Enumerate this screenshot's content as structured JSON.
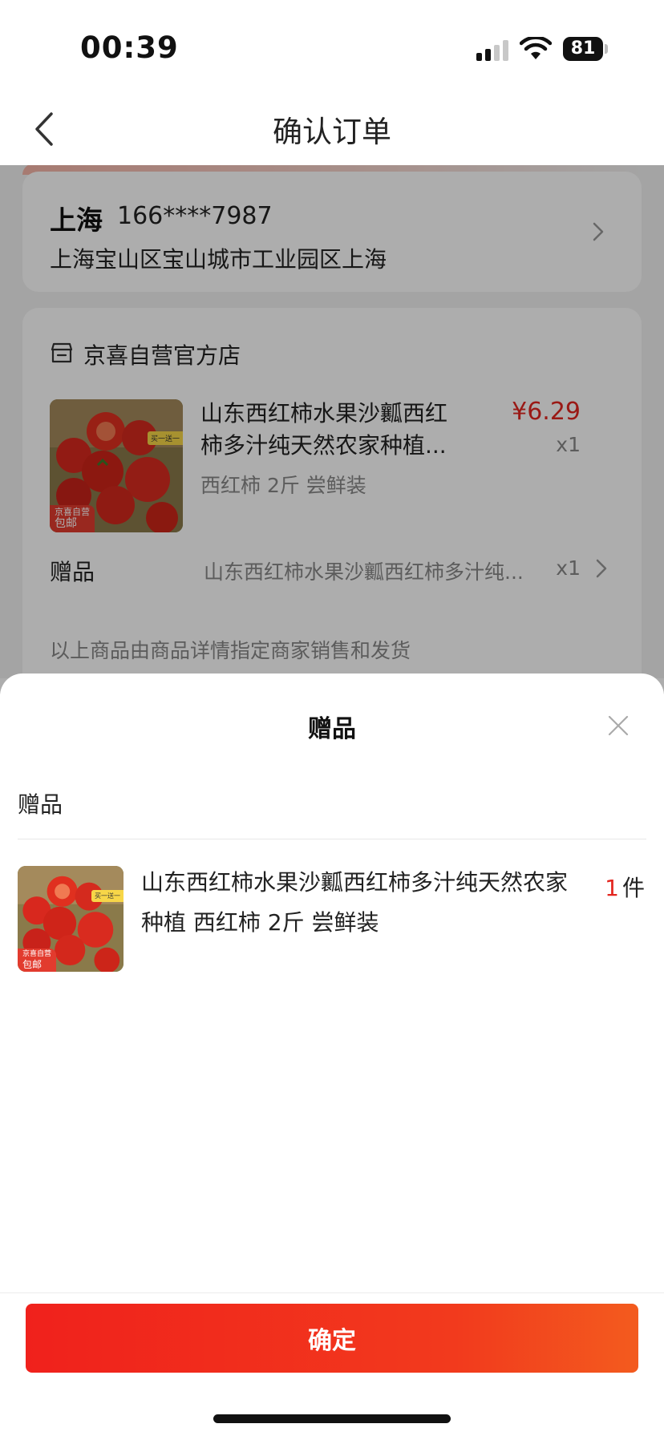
{
  "status_bar": {
    "time": "00:39",
    "battery": "81"
  },
  "nav": {
    "title": "确认订单"
  },
  "address": {
    "city": "上海",
    "phone": "166****7987",
    "detail": "上海宝山区宝山城市工业园区上海"
  },
  "store": {
    "name": "京喜自营官方店"
  },
  "product": {
    "title": "山东西红柿水果沙瓤西红柿多汁纯天然农家种植...",
    "spec": "西红柿 2斤 尝鲜装",
    "price": "¥6.29",
    "qty": "x1",
    "image_tag_top": "买一送一",
    "image_tag_bottom_1": "京喜自营",
    "image_tag_bottom_2": "包邮"
  },
  "gift_row": {
    "label": "赠品",
    "desc": "山东西红柿水果沙瓤西红柿多汁纯...",
    "qty": "x1"
  },
  "seller_note": "以上商品由商品详情指定商家销售和发货",
  "sheet": {
    "title": "赠品",
    "section_label": "赠品",
    "item": {
      "title": "山东西红柿水果沙瓤西红柿多汁纯天然农家种植 西红柿 2斤 尝鲜装",
      "qty_num": "1",
      "qty_unit": "件"
    },
    "confirm_label": "确定"
  },
  "colors": {
    "accent": "#e3261f",
    "button_start": "#f0211c",
    "button_end": "#f35b1e"
  },
  "icons": [
    "back-icon",
    "chevron-right-icon",
    "store-icon",
    "close-icon",
    "wifi-icon",
    "signal-icon",
    "battery-icon"
  ]
}
